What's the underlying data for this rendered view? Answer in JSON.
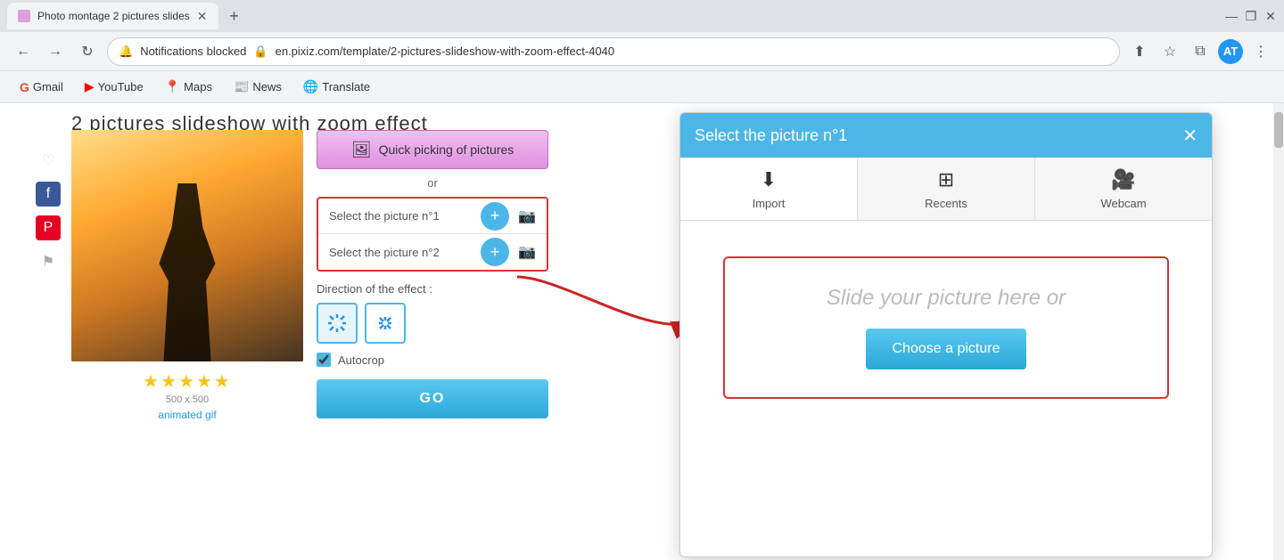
{
  "browser": {
    "tab_title": "Photo montage 2 pictures slides",
    "tab_new_label": "+",
    "window_minimize": "—",
    "window_maximize": "❐",
    "window_close": "✕",
    "nav_back": "←",
    "nav_forward": "→",
    "nav_refresh": "↻",
    "notification_label": "Notifications blocked",
    "lock_icon": "🔒",
    "url": "en.pixiz.com/template/2-pictures-slideshow-with-zoom-effect-4040",
    "share_icon": "⬆",
    "star_icon": "☆",
    "split_icon": "⧉",
    "avatar_label": "AT",
    "menu_icon": "⋮"
  },
  "bookmarks": [
    {
      "id": "gmail",
      "label": "Gmail",
      "icon": "G"
    },
    {
      "id": "youtube",
      "label": "YouTube",
      "icon": "▶"
    },
    {
      "id": "maps",
      "label": "Maps",
      "icon": "📍"
    },
    {
      "id": "news",
      "label": "News",
      "icon": "📰"
    },
    {
      "id": "translate",
      "label": "Translate",
      "icon": "🌐"
    }
  ],
  "page": {
    "title": "2 pictures slideshow with zoom effect",
    "stars": "★★★★★",
    "dimensions": "500 x 500",
    "animated_gif": "animated gif"
  },
  "controls": {
    "quick_pick_label": "Quick picking of pictures",
    "or_text": "or",
    "picture1_label": "Select the picture n°1",
    "picture2_label": "Select the picture n°2",
    "direction_label": "Direction of the effect :",
    "autocrop_label": "Autocrop",
    "go_label": "GO"
  },
  "dialog": {
    "title": "Select the picture n°1",
    "close_icon": "✕",
    "tabs": [
      {
        "id": "import",
        "label": "Import",
        "icon": "⬇"
      },
      {
        "id": "recents",
        "label": "Recents",
        "icon": "⊞"
      },
      {
        "id": "webcam",
        "label": "Webcam",
        "icon": "🎥"
      }
    ],
    "drop_text": "Slide your picture here or",
    "choose_btn_label": "Choose a picture"
  }
}
